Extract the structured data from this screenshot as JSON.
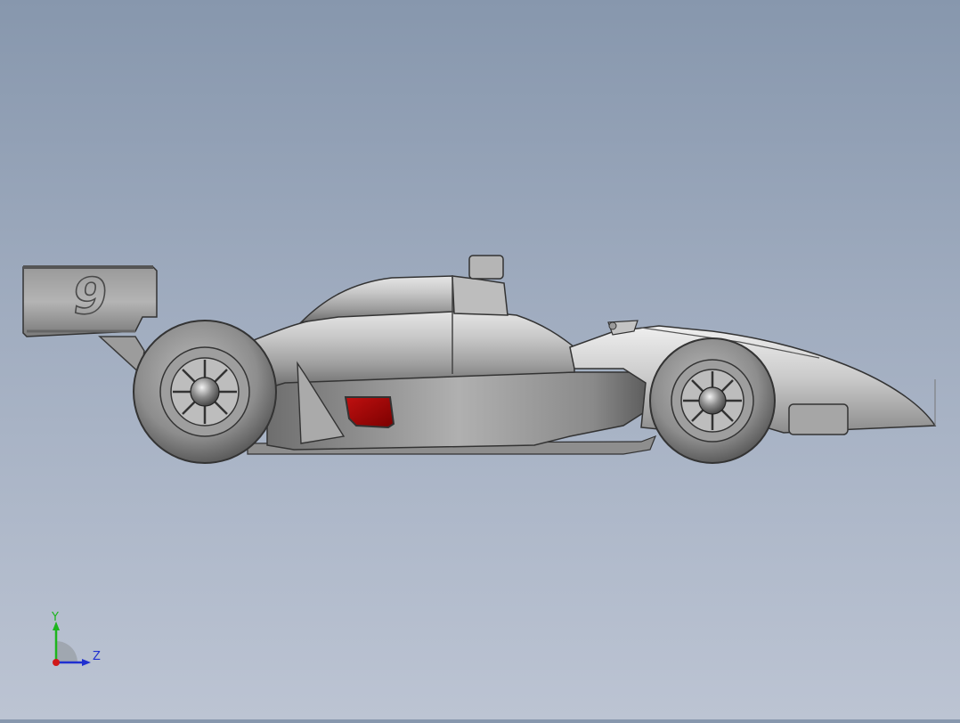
{
  "model": {
    "car_number": "9",
    "body_color": "#b7b7b7",
    "accent_color": "#a80000",
    "edge_color": "#3a3a3a"
  },
  "viewport": {
    "background_top": "#8797ad",
    "background_bottom": "#bcc4d3"
  },
  "triad": {
    "y_label": "Y",
    "z_label": "Z",
    "y_color": "#1db51d",
    "z_color": "#2030d0",
    "x_color": "#d01818"
  }
}
